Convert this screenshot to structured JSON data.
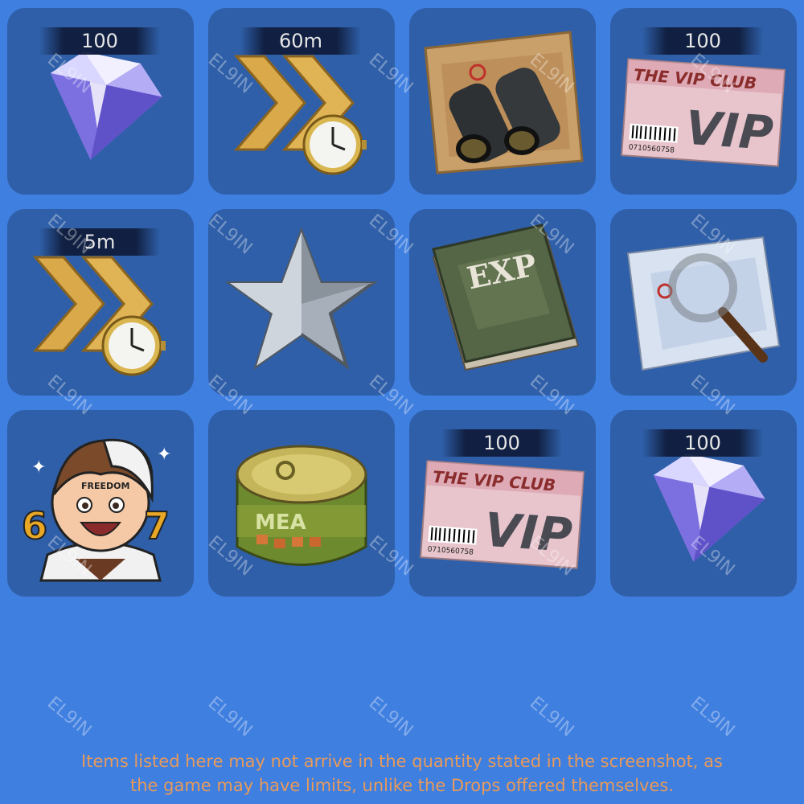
{
  "items": [
    {
      "name": "diamond",
      "quantity": "100",
      "icon": "diamond-icon"
    },
    {
      "name": "speedup-60m",
      "quantity": "60m",
      "icon": "speedup-clock-icon"
    },
    {
      "name": "binoculars-map",
      "quantity": "",
      "icon": "binoculars-map-icon"
    },
    {
      "name": "vip-card",
      "quantity": "100",
      "icon": "vip-card-icon",
      "card_title": "THE VIP CLUB",
      "card_badge": "VIP",
      "barcode": "0710560758"
    },
    {
      "name": "speedup-5m",
      "quantity": "5m",
      "icon": "speedup-clock-icon"
    },
    {
      "name": "silver-star",
      "quantity": "",
      "icon": "silver-star-icon"
    },
    {
      "name": "exp-book",
      "quantity": "",
      "icon": "exp-book-icon",
      "label": "EXP"
    },
    {
      "name": "magnifier-map",
      "quantity": "",
      "icon": "magnifier-map-icon"
    },
    {
      "name": "freedom-avatar",
      "quantity": "",
      "icon": "avatar-sticker-icon",
      "label": "FREEDOM",
      "numbers": "67"
    },
    {
      "name": "meat-can",
      "quantity": "",
      "icon": "meat-can-icon",
      "label": "MEA"
    },
    {
      "name": "vip-card-2",
      "quantity": "100",
      "icon": "vip-card-icon",
      "card_title": "THE VIP CLUB",
      "card_badge": "VIP",
      "barcode": "0710560758"
    },
    {
      "name": "diamond-2",
      "quantity": "100",
      "icon": "diamond-icon"
    }
  ],
  "watermark": "EL9IN",
  "disclaimer": {
    "line1": "Items listed here may not arrive in the quantity stated in the screenshot, as",
    "line2": "the game may have limits, unlike the Drops offered themselves."
  },
  "colors": {
    "background": "#3f7fe0",
    "tile": "#2f5fa8",
    "disclaimer": "#e89a5a"
  }
}
